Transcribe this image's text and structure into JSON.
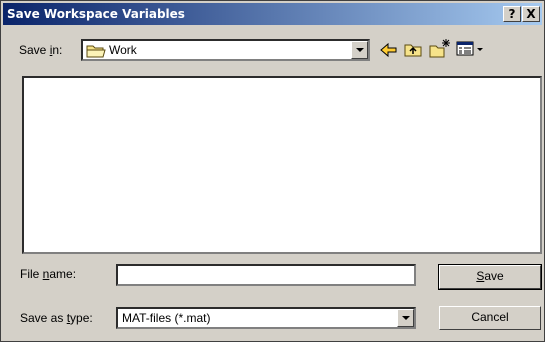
{
  "window": {
    "title": "Save Workspace Variables"
  },
  "titlebar": {
    "help": "?",
    "close": "X"
  },
  "toolbar": {
    "save_in_prefix": "Save ",
    "save_in_key": "i",
    "save_in_suffix": "n:",
    "location": "Work"
  },
  "form": {
    "file_name_prefix": "File ",
    "file_name_key": "n",
    "file_name_suffix": "ame:",
    "file_name_value": "",
    "save_type_prefix": "Save as ",
    "save_type_key": "t",
    "save_type_suffix": "ype:",
    "save_type_value": "MAT-files (*.mat)"
  },
  "buttons": {
    "save_key": "S",
    "save_rest": "ave",
    "cancel": "Cancel"
  }
}
